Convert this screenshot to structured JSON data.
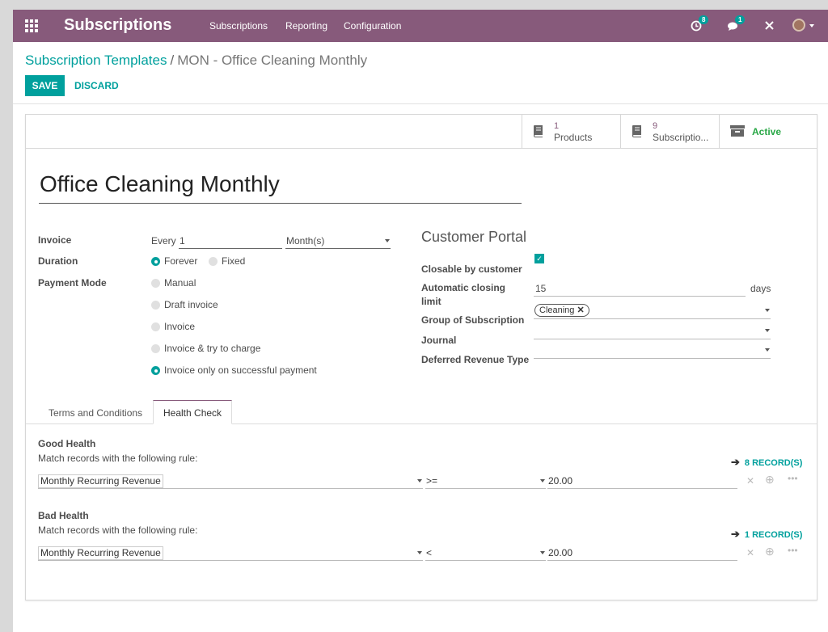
{
  "navbar": {
    "brand": "Subscriptions",
    "menu": [
      "Subscriptions",
      "Reporting",
      "Configuration"
    ],
    "activity_count": "8",
    "message_count": "1"
  },
  "breadcrumb": {
    "parent": "Subscription Templates",
    "separator": "/",
    "current": "MON - Office Cleaning Monthly"
  },
  "actions": {
    "save": "SAVE",
    "discard": "DISCARD"
  },
  "smart_buttons": {
    "products": {
      "count": "1",
      "label": "Products"
    },
    "subscriptions": {
      "count": "9",
      "label": "Subscriptio..."
    },
    "active": {
      "label": "Active"
    }
  },
  "form": {
    "name": "Office Cleaning Monthly",
    "invoice": {
      "label": "Invoice",
      "every": "Every",
      "interval": "1",
      "unit": "Month(s)"
    },
    "duration": {
      "label": "Duration",
      "options": [
        "Forever",
        "Fixed"
      ],
      "selected": "Forever"
    },
    "payment_mode": {
      "label": "Payment Mode",
      "options": [
        "Manual",
        "Draft invoice",
        "Invoice",
        "Invoice & try to charge",
        "Invoice only on successful payment"
      ],
      "selected": "Invoice only on successful payment"
    },
    "customer_portal": {
      "title": "Customer Portal",
      "closable_label": "Closable by customer",
      "closable": true,
      "auto_close_label_1": "Automatic closing",
      "auto_close_label_2": "limit",
      "auto_close_value": "15",
      "auto_close_unit": "days",
      "group_label": "Group of Subscription",
      "group_tag": "Cleaning",
      "journal_label": "Journal",
      "journal_value": "",
      "deferred_label": "Deferred Revenue Type",
      "deferred_value": ""
    }
  },
  "tabs": [
    "Terms and Conditions",
    "Health Check"
  ],
  "active_tab": "Health Check",
  "health": {
    "good": {
      "title": "Good Health",
      "subtitle": "Match records with the following rule:",
      "records": "8 RECORD(S)",
      "field": "Monthly Recurring Revenue",
      "operator": ">=",
      "value": "20.00"
    },
    "bad": {
      "title": "Bad Health",
      "subtitle": "Match records with the following rule:",
      "records": "1 RECORD(S)",
      "field": "Monthly Recurring Revenue",
      "operator": "<",
      "value": "20.00"
    }
  },
  "colors": {
    "brand": "#875a7b",
    "accent": "#00a09d"
  }
}
